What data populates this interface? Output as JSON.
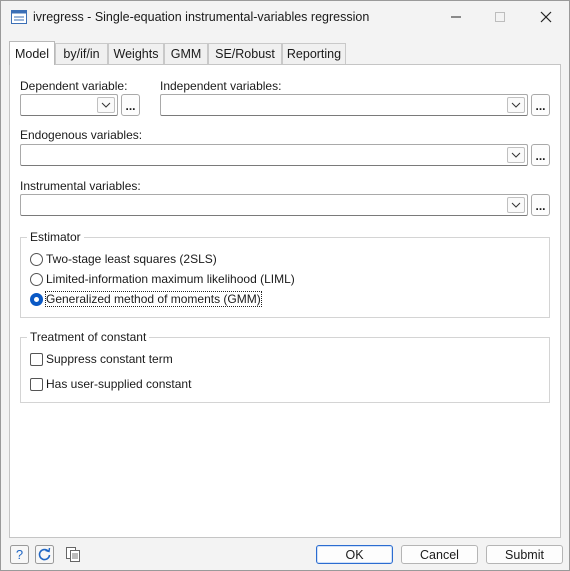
{
  "window": {
    "title": "ivregress - Single-equation instrumental-variables regression",
    "controls": {
      "minimize": "minimize",
      "maximize": "maximize",
      "close": "close"
    }
  },
  "tabs": [
    {
      "label": "Model",
      "active": true
    },
    {
      "label": "by/if/in",
      "active": false
    },
    {
      "label": "Weights",
      "active": false
    },
    {
      "label": "GMM",
      "active": false
    },
    {
      "label": "SE/Robust",
      "active": false
    },
    {
      "label": "Reporting",
      "active": false
    }
  ],
  "model": {
    "dependent_label": "Dependent variable:",
    "dependent_value": "",
    "independent_label": "Independent variables:",
    "independent_value": "",
    "endogenous_label": "Endogenous variables:",
    "endogenous_value": "",
    "instrumental_label": "Instrumental variables:",
    "instrumental_value": "",
    "browse_label": "..."
  },
  "estimator": {
    "title": "Estimator",
    "options": [
      {
        "label": "Two-stage least squares (2SLS)",
        "selected": false
      },
      {
        "label": "Limited-information maximum likelihood (LIML)",
        "selected": false
      },
      {
        "label": "Generalized method of moments (GMM)",
        "selected": true
      }
    ]
  },
  "constant": {
    "title": "Treatment of constant",
    "options": [
      {
        "label": "Suppress constant term",
        "checked": false
      },
      {
        "label": "Has user-supplied constant",
        "checked": false
      }
    ]
  },
  "footer": {
    "help_icon": "help-icon",
    "reset_icon": "reset-icon",
    "copy_icon": "copy-command-icon",
    "ok_label": "OK",
    "cancel_label": "Cancel",
    "submit_label": "Submit"
  },
  "colors": {
    "accent": "#0a59c5",
    "default_button_border": "#2b6cd0",
    "help_icon": "#1f66c4",
    "reset_icon": "#1f66c4"
  }
}
